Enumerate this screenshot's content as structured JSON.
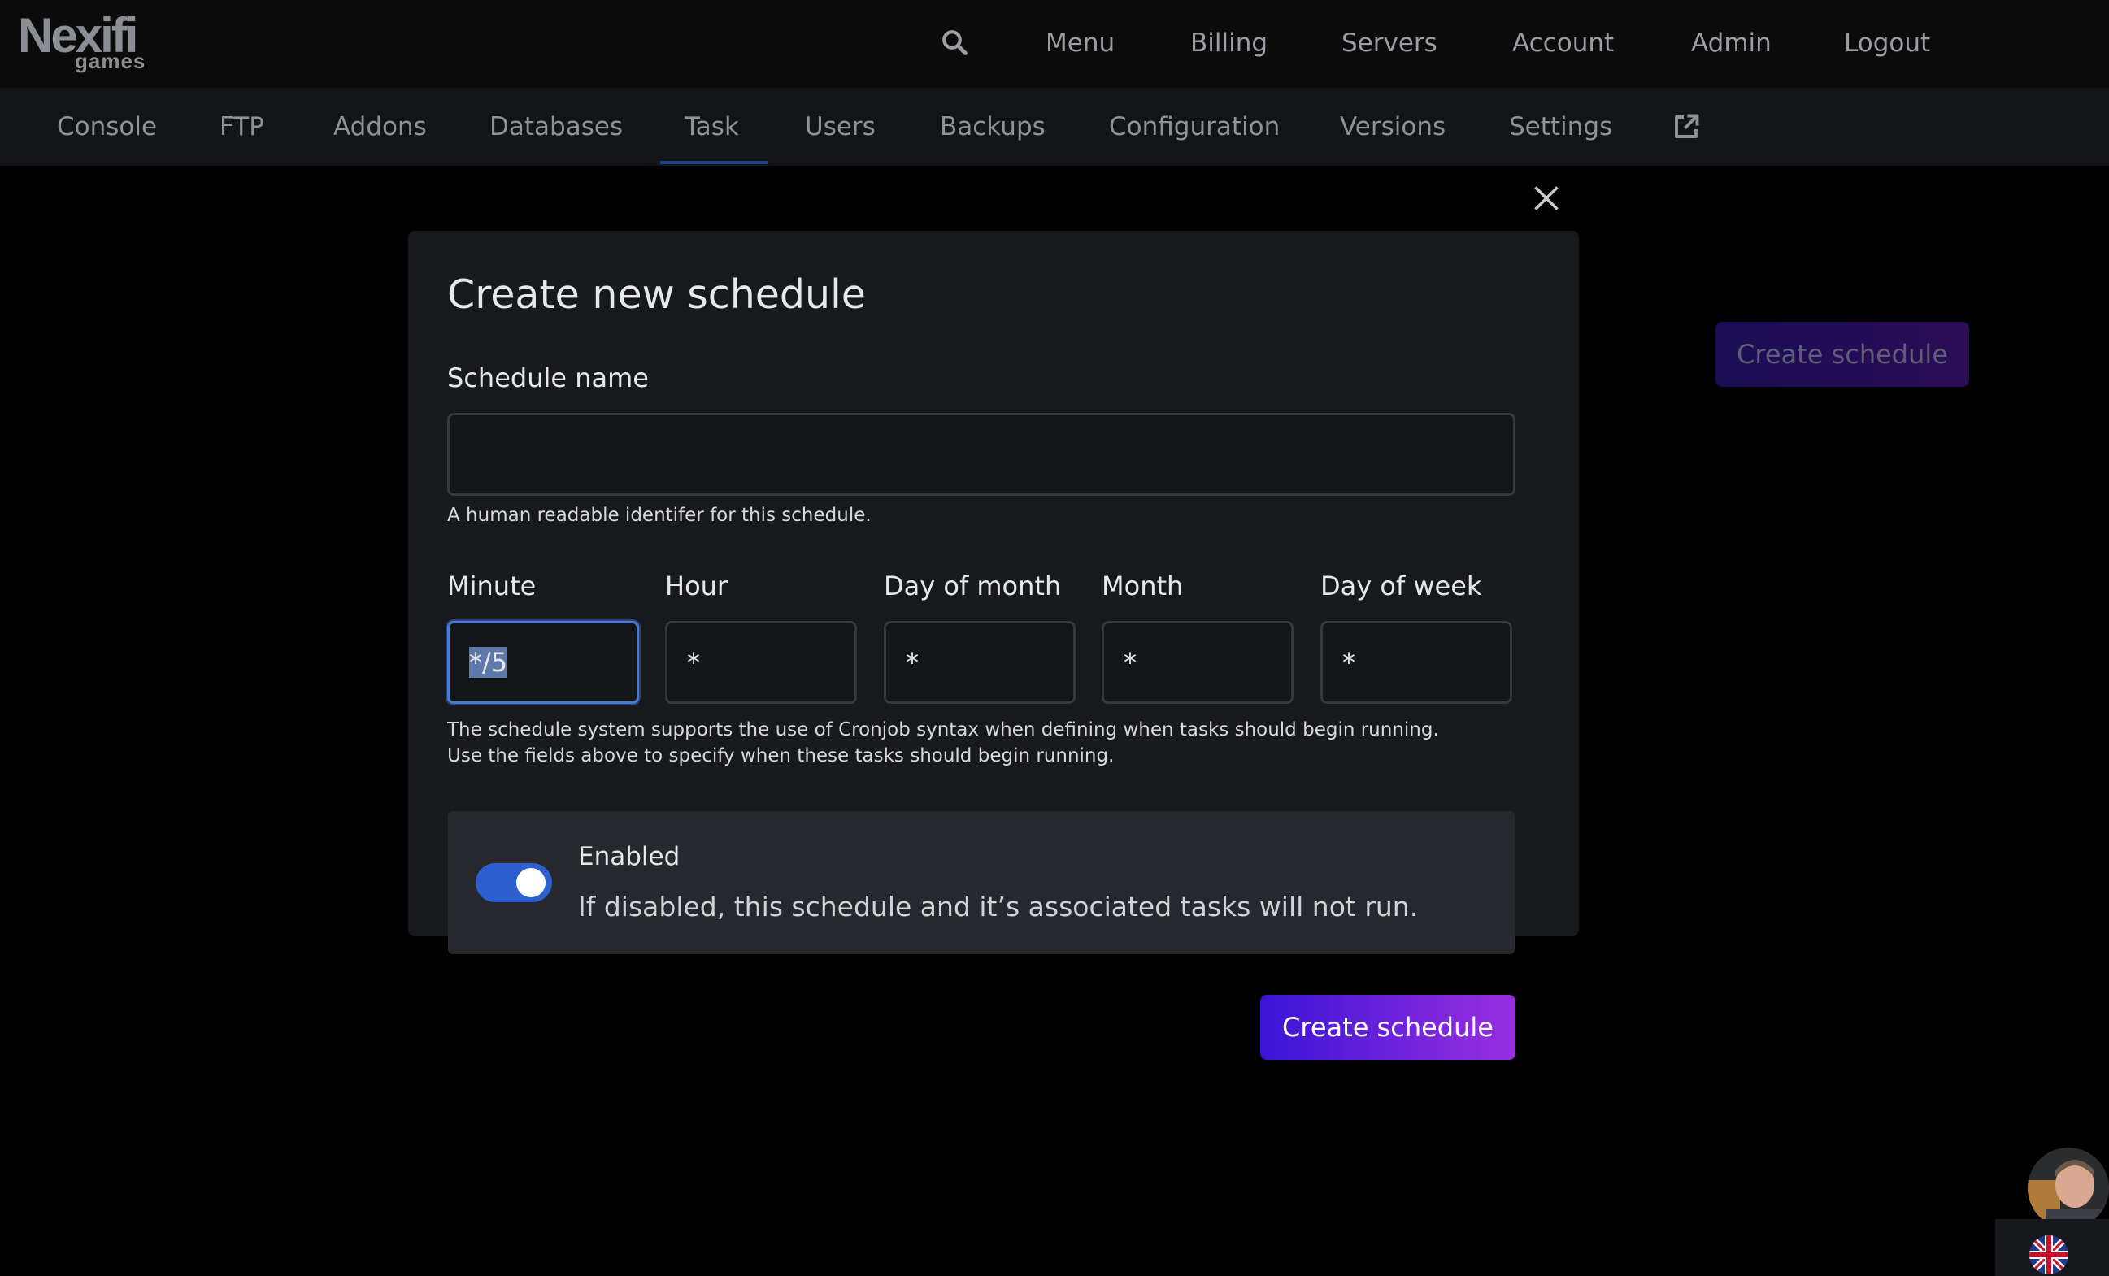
{
  "brand": {
    "name": "Nexifi",
    "sub": "games"
  },
  "topnav": {
    "items": [
      {
        "id": "menu",
        "label": "Menu"
      },
      {
        "id": "billing",
        "label": "Billing"
      },
      {
        "id": "servers",
        "label": "Servers"
      },
      {
        "id": "account",
        "label": "Account"
      },
      {
        "id": "admin",
        "label": "Admin"
      },
      {
        "id": "logout",
        "label": "Logout"
      }
    ],
    "search_icon": "search-icon"
  },
  "subnav": {
    "items": [
      {
        "id": "console",
        "label": "Console"
      },
      {
        "id": "ftp",
        "label": "FTP"
      },
      {
        "id": "addons",
        "label": "Addons"
      },
      {
        "id": "databases",
        "label": "Databases"
      },
      {
        "id": "task",
        "label": "Task",
        "active": true
      },
      {
        "id": "users",
        "label": "Users"
      },
      {
        "id": "backups",
        "label": "Backups"
      },
      {
        "id": "configuration",
        "label": "Configuration"
      },
      {
        "id": "versions",
        "label": "Versions"
      },
      {
        "id": "settings",
        "label": "Settings"
      }
    ],
    "external_icon": "external-link-icon"
  },
  "background": {
    "create_button_label": "Create schedule"
  },
  "modal": {
    "title": "Create new schedule",
    "close_icon": "close-icon",
    "name_label": "Schedule name",
    "name_value": "",
    "name_help": "A human readable identifer for this schedule.",
    "cron": {
      "fields": [
        {
          "id": "minute",
          "label": "Minute",
          "value": "*/5"
        },
        {
          "id": "hour",
          "label": "Hour",
          "value": "*"
        },
        {
          "id": "day-of-month",
          "label": "Day of month",
          "value": "*"
        },
        {
          "id": "month",
          "label": "Month",
          "value": "*"
        },
        {
          "id": "day-of-week",
          "label": "Day of week",
          "value": "*"
        }
      ],
      "help_line1": "The schedule system supports the use of Cronjob syntax when defining when tasks should begin running.",
      "help_line2": "Use the fields above to specify when these tasks should begin running."
    },
    "enabled": {
      "title": "Enabled",
      "description": "If disabled, this schedule and it’s associated tasks will not run.",
      "on": true
    },
    "submit_label": "Create schedule"
  },
  "colors": {
    "accent_start": "#3a14d6",
    "accent_end": "#9a2fe0",
    "toggle_on": "#2d5fd1",
    "focus_ring": "#4b7bd0"
  }
}
